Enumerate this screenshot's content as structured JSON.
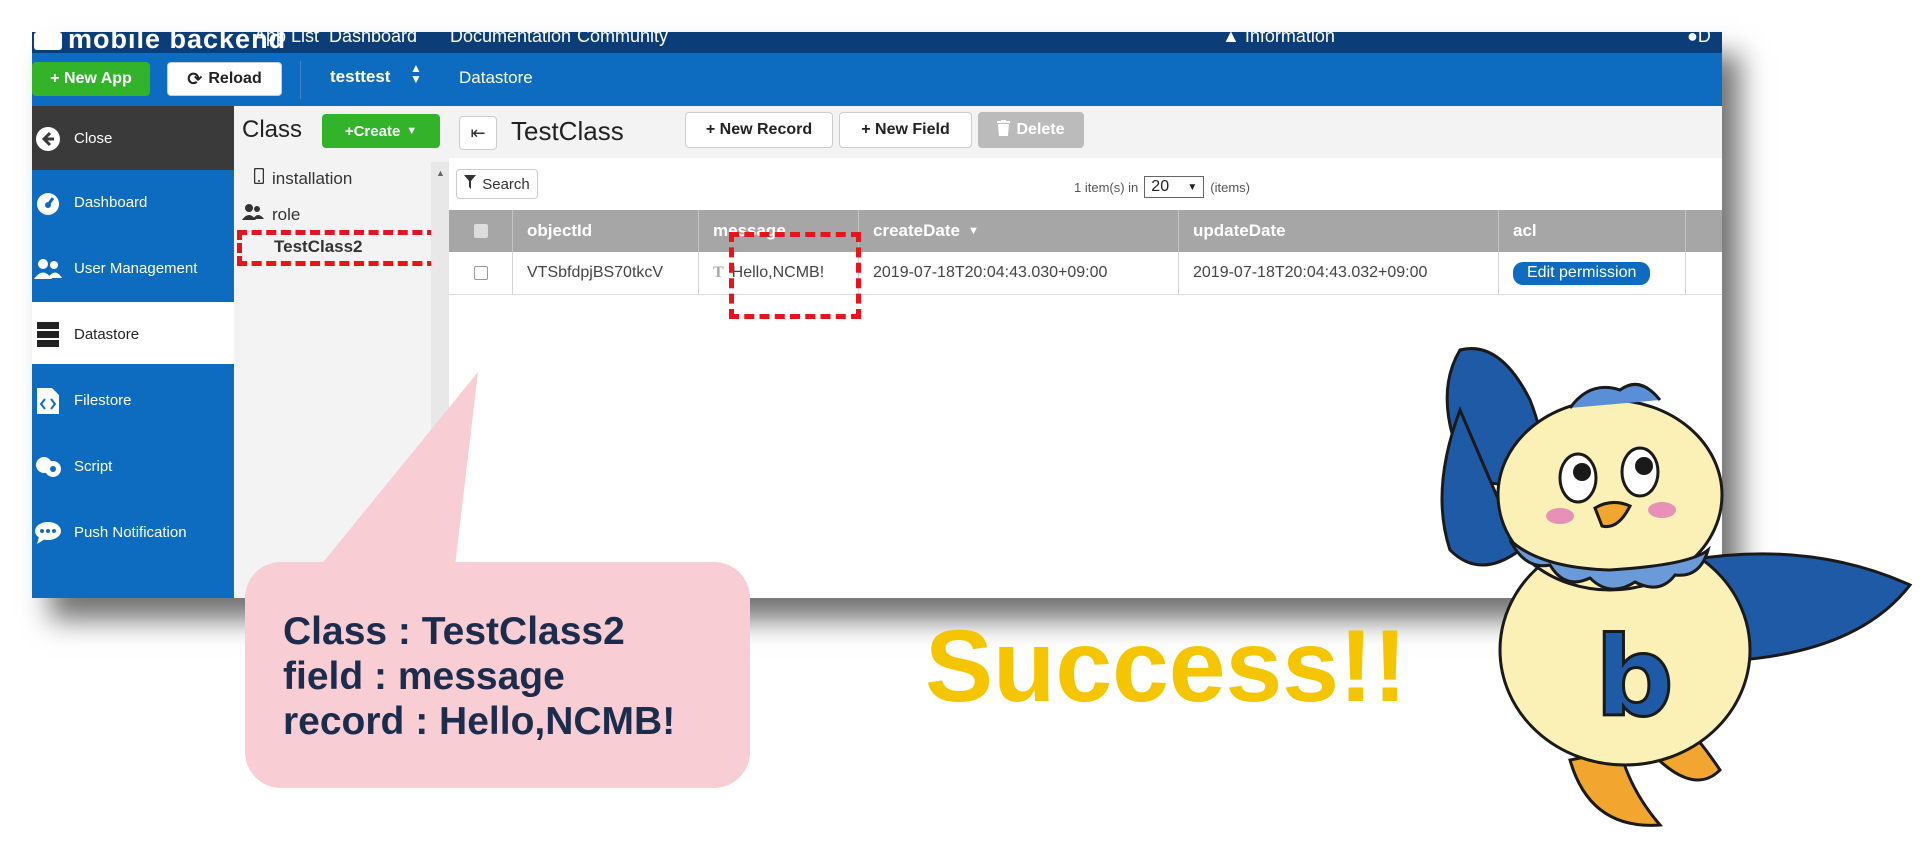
{
  "topnav": {
    "logo": "mobile backend",
    "items": [
      "App List",
      "Dashboard",
      "Documentation",
      "Community"
    ],
    "info": "Information",
    "user": "D"
  },
  "toolbar": {
    "new_app": "+ New App",
    "reload": "Reload",
    "app_name": "testtest",
    "breadcrumb": "Datastore"
  },
  "sidebar": {
    "items": [
      {
        "label": "Close",
        "icon": "arrow-left-circle-icon"
      },
      {
        "label": "Dashboard",
        "icon": "speedometer-icon"
      },
      {
        "label": "User Management",
        "icon": "users-icon"
      },
      {
        "label": "Datastore",
        "icon": "server-icon"
      },
      {
        "label": "Filestore",
        "icon": "file-code-icon"
      },
      {
        "label": "Script",
        "icon": "cloud-gear-icon"
      },
      {
        "label": "Push Notification",
        "icon": "chat-bubble-icon"
      }
    ]
  },
  "classes": {
    "title": "Class",
    "create": "+Create",
    "items": [
      "installation",
      "role",
      "TestClass2"
    ]
  },
  "main": {
    "title": "TestClass",
    "new_record": "+ New Record",
    "new_field": "+ New Field",
    "delete": "Delete",
    "search": "Search",
    "count_text": "1 item(s) in",
    "per_page": "20",
    "items_text": "(items)"
  },
  "table": {
    "columns": [
      "objectId",
      "message",
      "createDate",
      "updateDate",
      "acl"
    ],
    "rows": [
      {
        "objectId": "VTSbfdpjBS70tkcV",
        "message": "Hello,NCMB!",
        "createDate": "2019-07-18T20:04:43.030+09:00",
        "updateDate": "2019-07-18T20:04:43.032+09:00",
        "acl": "Edit permission"
      }
    ]
  },
  "callout": {
    "line1": "Class : TestClass2",
    "line2": "field : message",
    "line3": "record : Hello,NCMB!"
  },
  "success": "Success!!",
  "mascot_letter": "b",
  "colors": {
    "nav_dark": "#0b3d78",
    "primary_blue": "#0d6cbf",
    "green": "#32b32a",
    "dash_red": "#e8141b",
    "callout_pink": "#f8cdd3",
    "success_yellow": "#f5c600"
  }
}
